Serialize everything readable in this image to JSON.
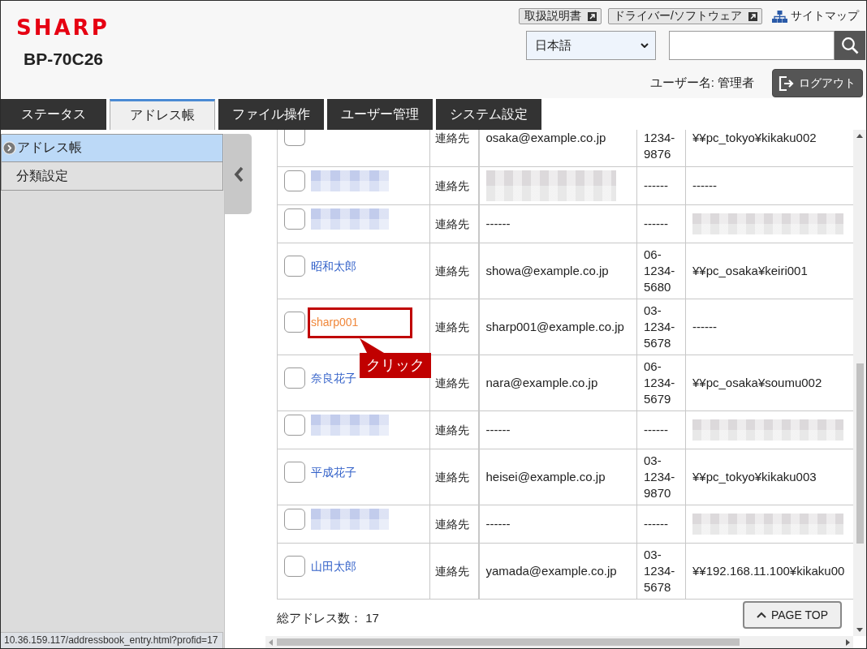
{
  "header": {
    "logo": "SHARP",
    "model": "BP-70C26",
    "links": [
      {
        "label": "取扱説明書",
        "kind": "button"
      },
      {
        "label": "ドライバー/ソフトウェア",
        "kind": "button"
      },
      {
        "label": "サイトマップ",
        "kind": "link"
      }
    ],
    "language": "日本語",
    "user_label": "ユーザー名: 管理者",
    "logout": "ログアウト"
  },
  "tabs": [
    {
      "label": "ステータス",
      "selected": false
    },
    {
      "label": "アドレス帳",
      "selected": true
    },
    {
      "label": "ファイル操作",
      "selected": false
    },
    {
      "label": "ユーザー管理",
      "selected": false
    },
    {
      "label": "システム設定",
      "selected": false
    }
  ],
  "sidebar": {
    "items": [
      {
        "label": "アドレス帳",
        "selected": true
      },
      {
        "label": "分類設定",
        "selected": false
      }
    ]
  },
  "table": {
    "rows": [
      {
        "checked": false,
        "highlighted": false,
        "name_redacted": false,
        "type": "連絡先",
        "email_redacted": false,
        "email": "osaka@example.co.jp",
        "phone": "1234-9876",
        "folder_redacted": false,
        "folder": "¥¥pc_tokyo¥kikaku002"
      },
      {
        "checked": false,
        "highlighted": false,
        "name_redacted": true,
        "type": "連絡先",
        "email_redacted": true,
        "phone": "------",
        "folder_redacted": false,
        "folder": "------"
      },
      {
        "checked": false,
        "highlighted": false,
        "name_redacted": true,
        "type": "連絡先",
        "email_redacted": false,
        "email": "------",
        "phone": "------",
        "folder_redacted": true
      },
      {
        "checked": false,
        "highlighted": false,
        "name_redacted": false,
        "name": "昭和太郎",
        "type": "連絡先",
        "email_redacted": false,
        "email": "showa@example.co.jp",
        "phone": "06-1234-5680",
        "folder_redacted": false,
        "folder": "¥¥pc_osaka¥keiri001"
      },
      {
        "checked": false,
        "highlighted": true,
        "name_redacted": false,
        "name": "sharp001",
        "callout": "クリック",
        "type": "連絡先",
        "email_redacted": false,
        "email": "sharp001@example.co.jp",
        "phone": "03-1234-5678",
        "folder_redacted": false,
        "folder": "------"
      },
      {
        "checked": false,
        "highlighted": false,
        "name_redacted": false,
        "name": "奈良花子",
        "type": "連絡先",
        "email_redacted": false,
        "email": "nara@example.co.jp",
        "phone": "06-1234-5679",
        "folder_redacted": false,
        "folder": "¥¥pc_osaka¥soumu002"
      },
      {
        "checked": false,
        "highlighted": false,
        "name_redacted": true,
        "type": "連絡先",
        "email_redacted": false,
        "email": "------",
        "phone": "------",
        "folder_redacted": true
      },
      {
        "checked": false,
        "highlighted": false,
        "name_redacted": false,
        "name": "平成花子",
        "type": "連絡先",
        "email_redacted": false,
        "email": "heisei@example.co.jp",
        "phone": "03-1234-9870",
        "folder_redacted": false,
        "folder": "¥¥pc_tokyo¥kikaku003"
      },
      {
        "checked": false,
        "highlighted": false,
        "name_redacted": true,
        "type": "連絡先",
        "email_redacted": false,
        "email": "------",
        "phone": "------",
        "folder_redacted": true
      },
      {
        "checked": false,
        "highlighted": false,
        "name_redacted": false,
        "name": "山田太郎",
        "type": "連絡先",
        "email_redacted": false,
        "email": "yamada@example.co.jp",
        "phone": "03-1234-5678",
        "folder_redacted": false,
        "folder": "¥¥192.168.11.100¥kikaku00"
      }
    ]
  },
  "total": "総アドレス数： 17",
  "page_top": "PAGE TOP",
  "status_url": "10.36.159.117/addressbook_entry.html?profid=17"
}
